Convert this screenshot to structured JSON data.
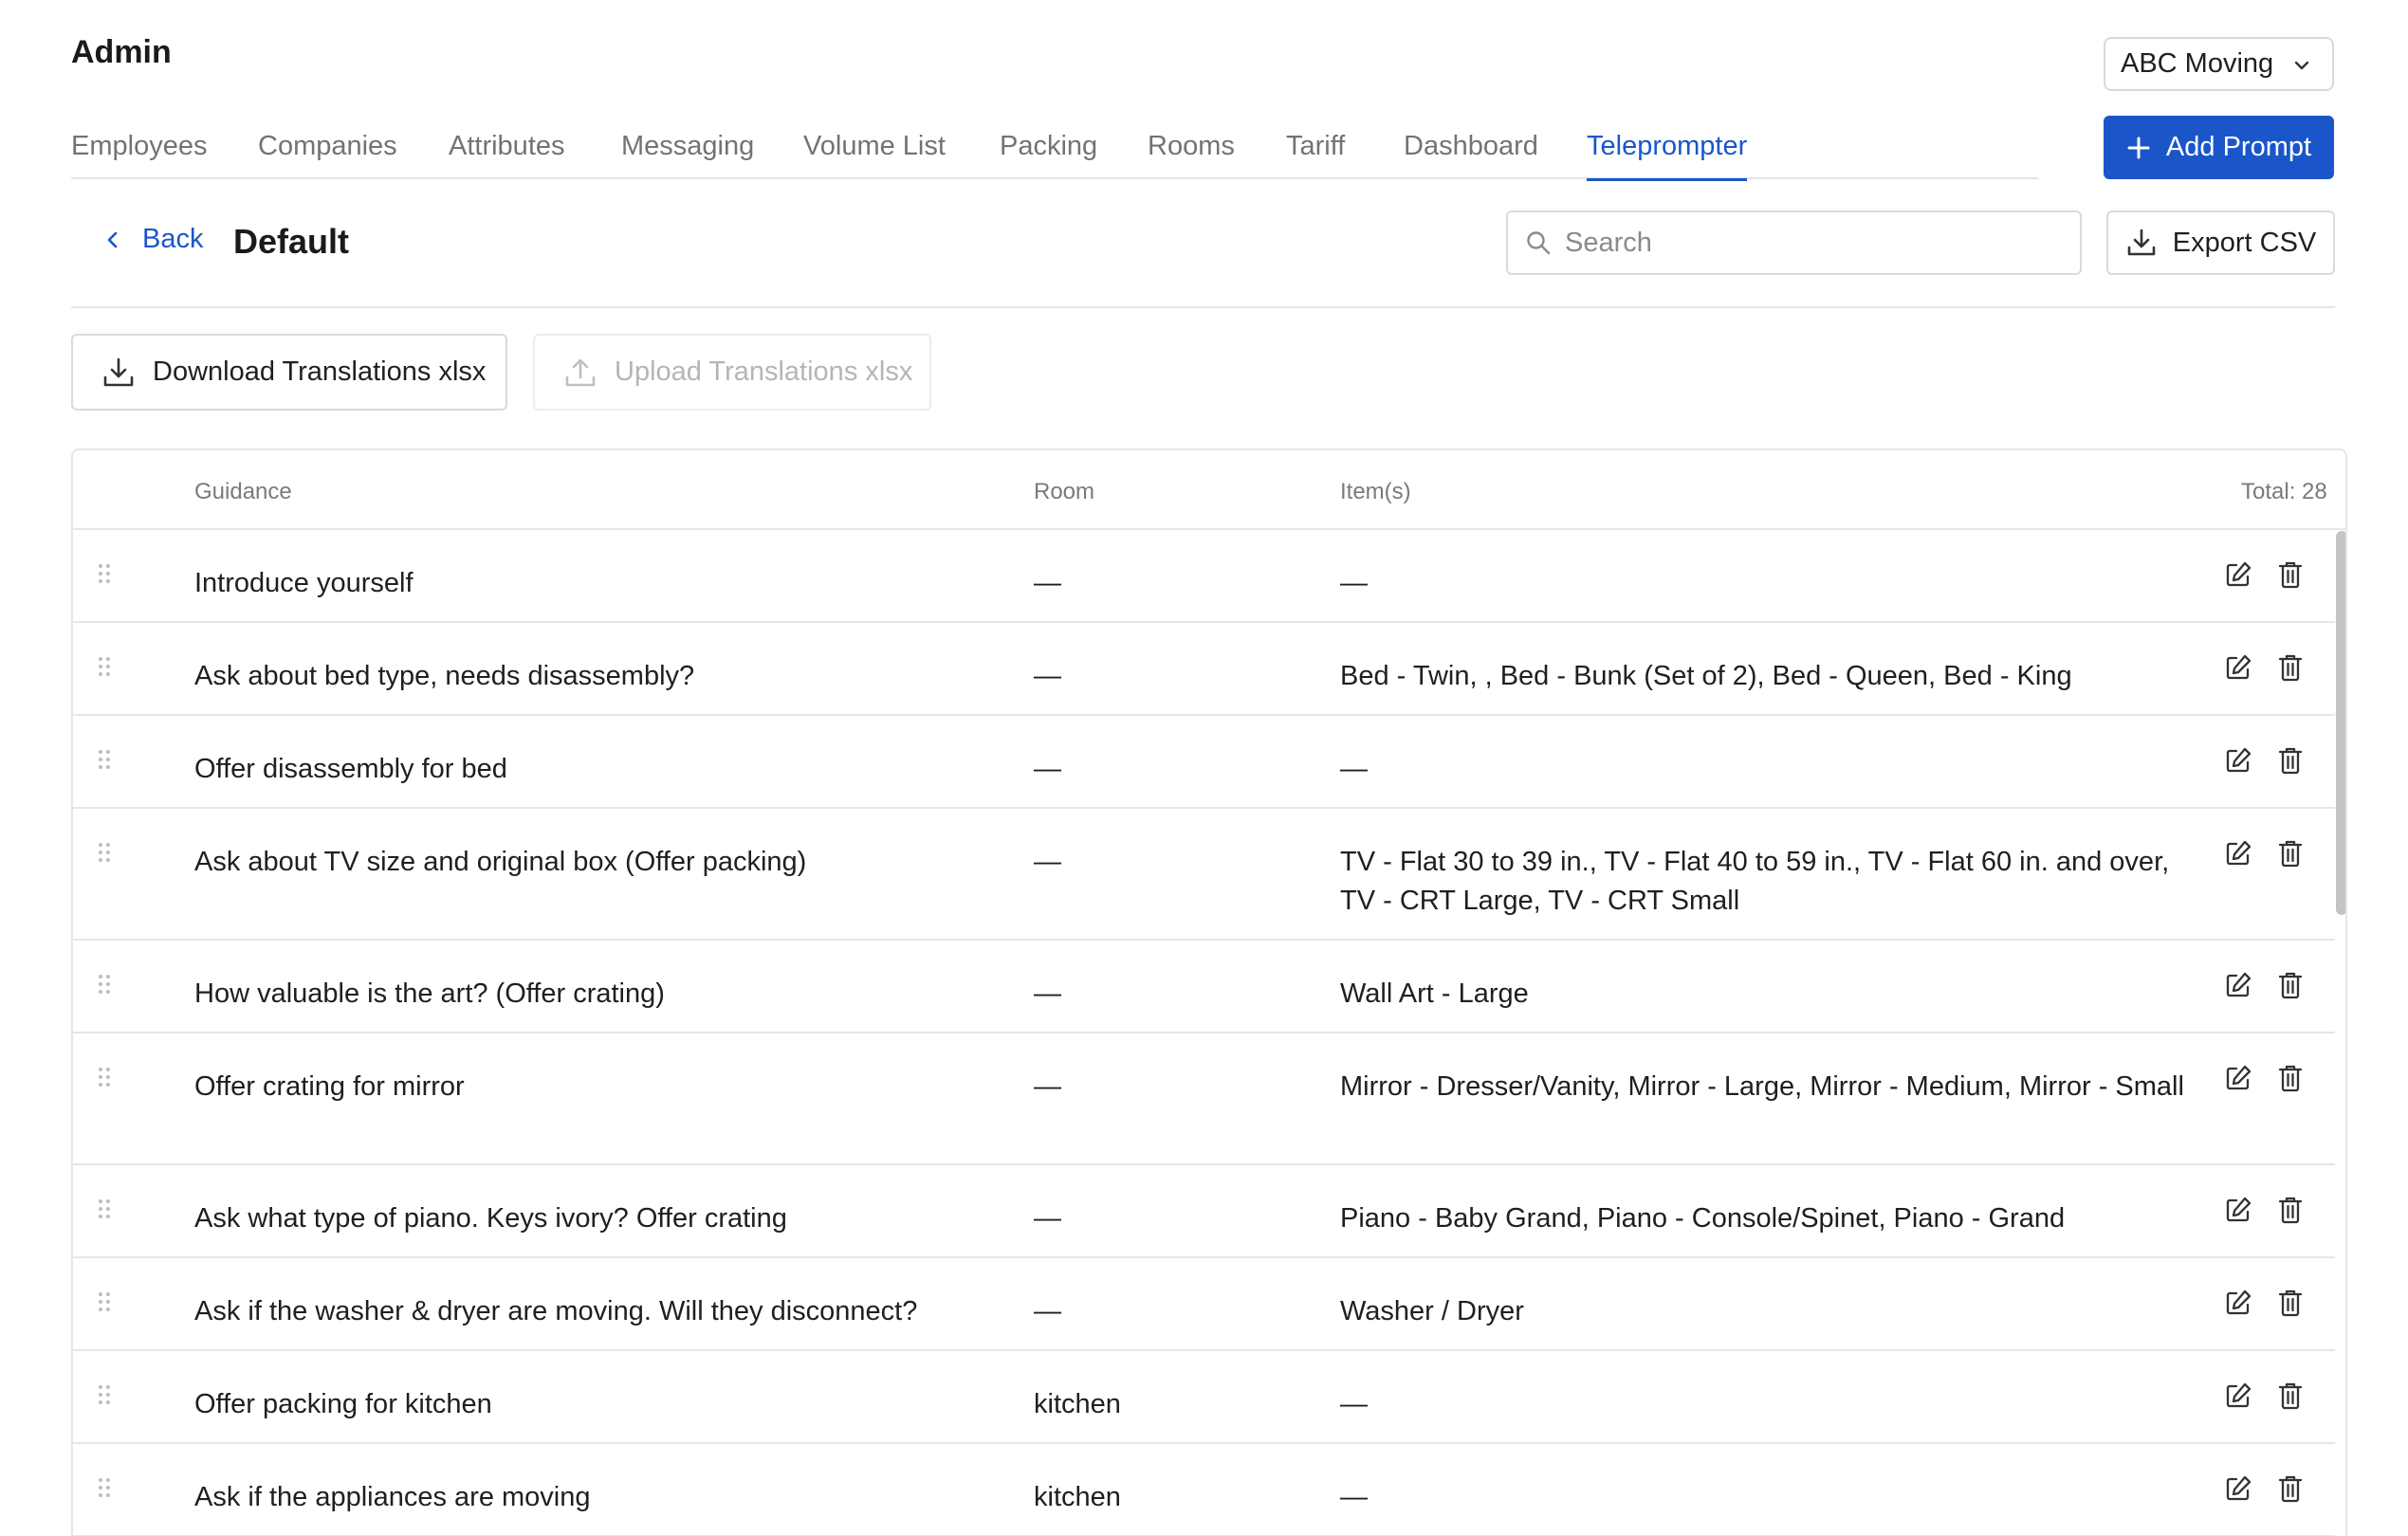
{
  "header": {
    "title": "Admin",
    "company": "ABC Moving"
  },
  "tabs": [
    {
      "label": "Employees"
    },
    {
      "label": "Companies"
    },
    {
      "label": "Attributes"
    },
    {
      "label": "Messaging"
    },
    {
      "label": "Volume List"
    },
    {
      "label": "Packing"
    },
    {
      "label": "Rooms"
    },
    {
      "label": "Tariff"
    },
    {
      "label": "Dashboard"
    },
    {
      "label": "Teleprompter",
      "active": true
    }
  ],
  "add_prompt_label": "Add Prompt",
  "subheader": {
    "back_label": "Back",
    "title": "Default",
    "search_placeholder": "Search",
    "export_label": "Export CSV"
  },
  "actions": {
    "download_label": "Download Translations xlsx",
    "upload_label": "Upload Translations xlsx"
  },
  "table": {
    "columns": {
      "guidance": "Guidance",
      "room": "Room",
      "items": "Item(s)",
      "total": "Total: 28"
    },
    "rows": [
      {
        "guidance": "Introduce yourself",
        "room": "—",
        "items": "—"
      },
      {
        "guidance": "Ask about bed type, needs disassembly?",
        "room": "—",
        "items": "Bed - Twin, , Bed - Bunk (Set of 2), Bed - Queen, Bed - King"
      },
      {
        "guidance": "Offer disassembly for bed",
        "room": "—",
        "items": "—"
      },
      {
        "guidance": "Ask about TV size and original box (Offer packing)",
        "room": "—",
        "items": "TV - Flat 30 to 39 in., TV - Flat 40 to 59 in., TV - Flat 60 in. and over, TV - CRT Large, TV - CRT Small"
      },
      {
        "guidance": "How valuable is the art? (Offer crating)",
        "room": "—",
        "items": "Wall Art - Large"
      },
      {
        "guidance": "Offer crating for mirror",
        "room": "—",
        "items": "Mirror - Dresser/Vanity, Mirror - Large, Mirror - Medium, Mirror - Small"
      },
      {
        "guidance": "Ask what type of piano. Keys ivory? Offer crating",
        "room": "—",
        "items": "Piano - Baby Grand, Piano - Console/Spinet, Piano - Grand"
      },
      {
        "guidance": "Ask if the washer & dryer are moving. Will they disconnect?",
        "room": "—",
        "items": "Washer / Dryer"
      },
      {
        "guidance": "Offer packing for kitchen",
        "room": "kitchen",
        "items": "—"
      },
      {
        "guidance": "Ask if the appliances are moving",
        "room": "kitchen",
        "items": "—"
      }
    ]
  },
  "colors": {
    "accent": "#1a56c9",
    "border": "#e6e6e6",
    "muted": "#7a7a7a"
  }
}
